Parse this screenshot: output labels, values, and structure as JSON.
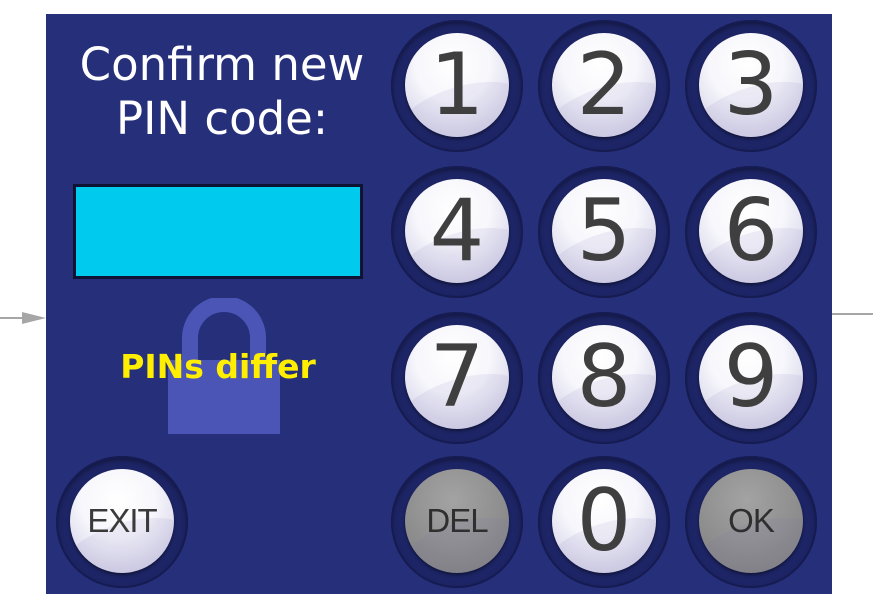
{
  "prompt": {
    "line1": "Confirm new",
    "line2": "PIN code:"
  },
  "pin_display": {
    "value": ""
  },
  "status": {
    "text": "PINs differ",
    "color": "#ffee00"
  },
  "keypad": {
    "keys": [
      {
        "label": "1"
      },
      {
        "label": "2"
      },
      {
        "label": "3"
      },
      {
        "label": "4"
      },
      {
        "label": "5"
      },
      {
        "label": "6"
      },
      {
        "label": "7"
      },
      {
        "label": "8"
      },
      {
        "label": "9"
      },
      {
        "label": "DEL"
      },
      {
        "label": "0"
      },
      {
        "label": "OK"
      }
    ],
    "exit_label": "EXIT"
  },
  "icons": {
    "lock": "lock-icon",
    "arrow": "arrow-right-icon"
  },
  "colors": {
    "panel": "#262f7a",
    "display": "#00cbef",
    "status": "#ffee00",
    "disabled_key": "#8e8e8e"
  }
}
